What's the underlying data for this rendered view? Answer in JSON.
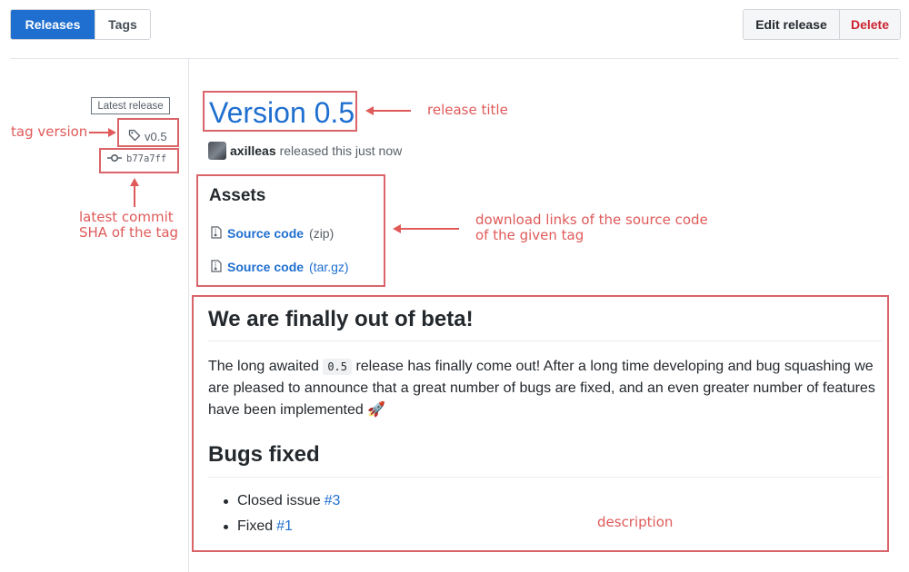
{
  "tabs": [
    {
      "label": "Releases"
    },
    {
      "label": "Tags"
    }
  ],
  "actions": {
    "edit_label": "Edit release",
    "delete_label": "Delete"
  },
  "sidebar": {
    "badge": "Latest release",
    "tag": "v0.5",
    "commit": "b77a7ff"
  },
  "release": {
    "title": "Version 0.5",
    "author": "axilleas",
    "released_text": "released this just now"
  },
  "assets": {
    "title": "Assets",
    "items": [
      {
        "label": "Source code",
        "format": "(zip)"
      },
      {
        "label": "Source code",
        "format": "(tar.gz)"
      }
    ]
  },
  "description": {
    "heading": "We are finally out of beta!",
    "para_before": "The long awaited",
    "code": "0.5",
    "para_after": "release has finally come out! After a long time developing and bug squashing we are pleased to announce that a great number of bugs are fixed, and an even greater number of features have been implemented",
    "emoji": "🚀",
    "bugs_heading": "Bugs fixed",
    "bugs": [
      {
        "text": "Closed issue",
        "link": "#3"
      },
      {
        "text": "Fixed",
        "link": "#1"
      }
    ]
  },
  "annotations": {
    "tag_version": "tag version",
    "latest_commit_line1": "latest commit",
    "latest_commit_line2": "SHA of the tag",
    "release_title": "release title",
    "download_line1": "download links of the source code",
    "download_line2": "of the given tag",
    "description": "description"
  },
  "colors": {
    "accent": "#1f6fd0",
    "danger": "#cb2431",
    "annotation": "#e05a5a"
  },
  "icons": [
    "tag-icon",
    "commit-icon",
    "file-zip-icon",
    "avatar"
  ]
}
